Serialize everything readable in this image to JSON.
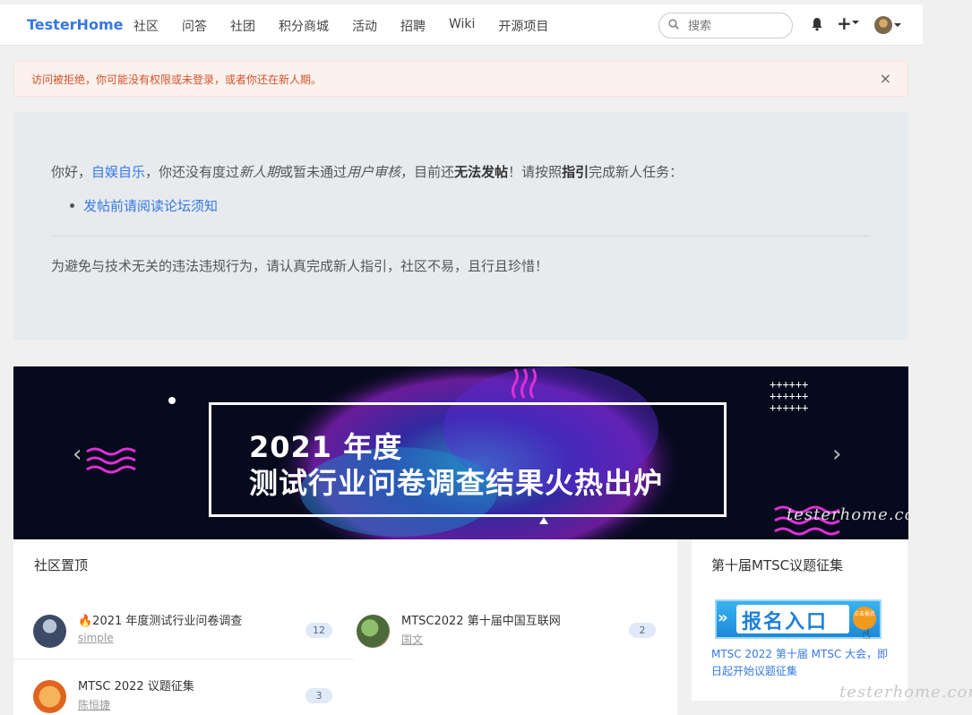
{
  "navbar": {
    "brand": "TesterHome",
    "links": [
      "社区",
      "问答",
      "社团",
      "积分商城",
      "活动",
      "招聘",
      "Wiki",
      "开源项目"
    ],
    "search_placeholder": "搜索",
    "plus_label": "+"
  },
  "alert": {
    "text": "访问被拒绝，你可能没有权限或未登录，或者你还在新人期。",
    "close": "×"
  },
  "notice": {
    "greeting": "你好，",
    "username": "自娱自乐",
    "seg1": "，你还没有度过",
    "em1": "新人期",
    "seg2": "或暂未通过",
    "em2": "用户审核",
    "seg3": "，目前还",
    "bold1": "无法发帖",
    "seg4": "！请按照",
    "bold2": "指引",
    "seg5": "完成新人任务：",
    "task_link": "发帖前请阅读论坛须知",
    "footer": "为避免与技术无关的违法违规行为，请认真完成新人指引，社区不易，且行且珍惜！"
  },
  "banner": {
    "line1": "2021 年度",
    "line2": "测试行业问卷调查结果火热出炉",
    "watermark": "testerhome.com",
    "prev": "‹",
    "next": "›"
  },
  "pinned": {
    "title": "社区置顶",
    "topics": [
      {
        "title": "🔥2021 年度测试行业问卷调查",
        "author": "simple",
        "count": "12"
      },
      {
        "title": "MTSC2022 第十届中国互联网",
        "author": "国文",
        "count": "2"
      },
      {
        "title": "MTSC 2022 议题征集",
        "author": "陈恒捷",
        "count": "3"
      }
    ]
  },
  "sidebar": {
    "title": "第十届MTSC议题征集",
    "ad_text": "报名入口",
    "ad_button": "点击报名",
    "caption": "MTSC 2022 第十届 MTSC 大会，即日起开始议题征集"
  },
  "page_watermark": "testerhome.com",
  "colors": {
    "brand": "#3578e5",
    "alert_text": "#d2522c",
    "alert_bg": "#fcf1ec",
    "badge_bg": "#e0e9f7"
  }
}
